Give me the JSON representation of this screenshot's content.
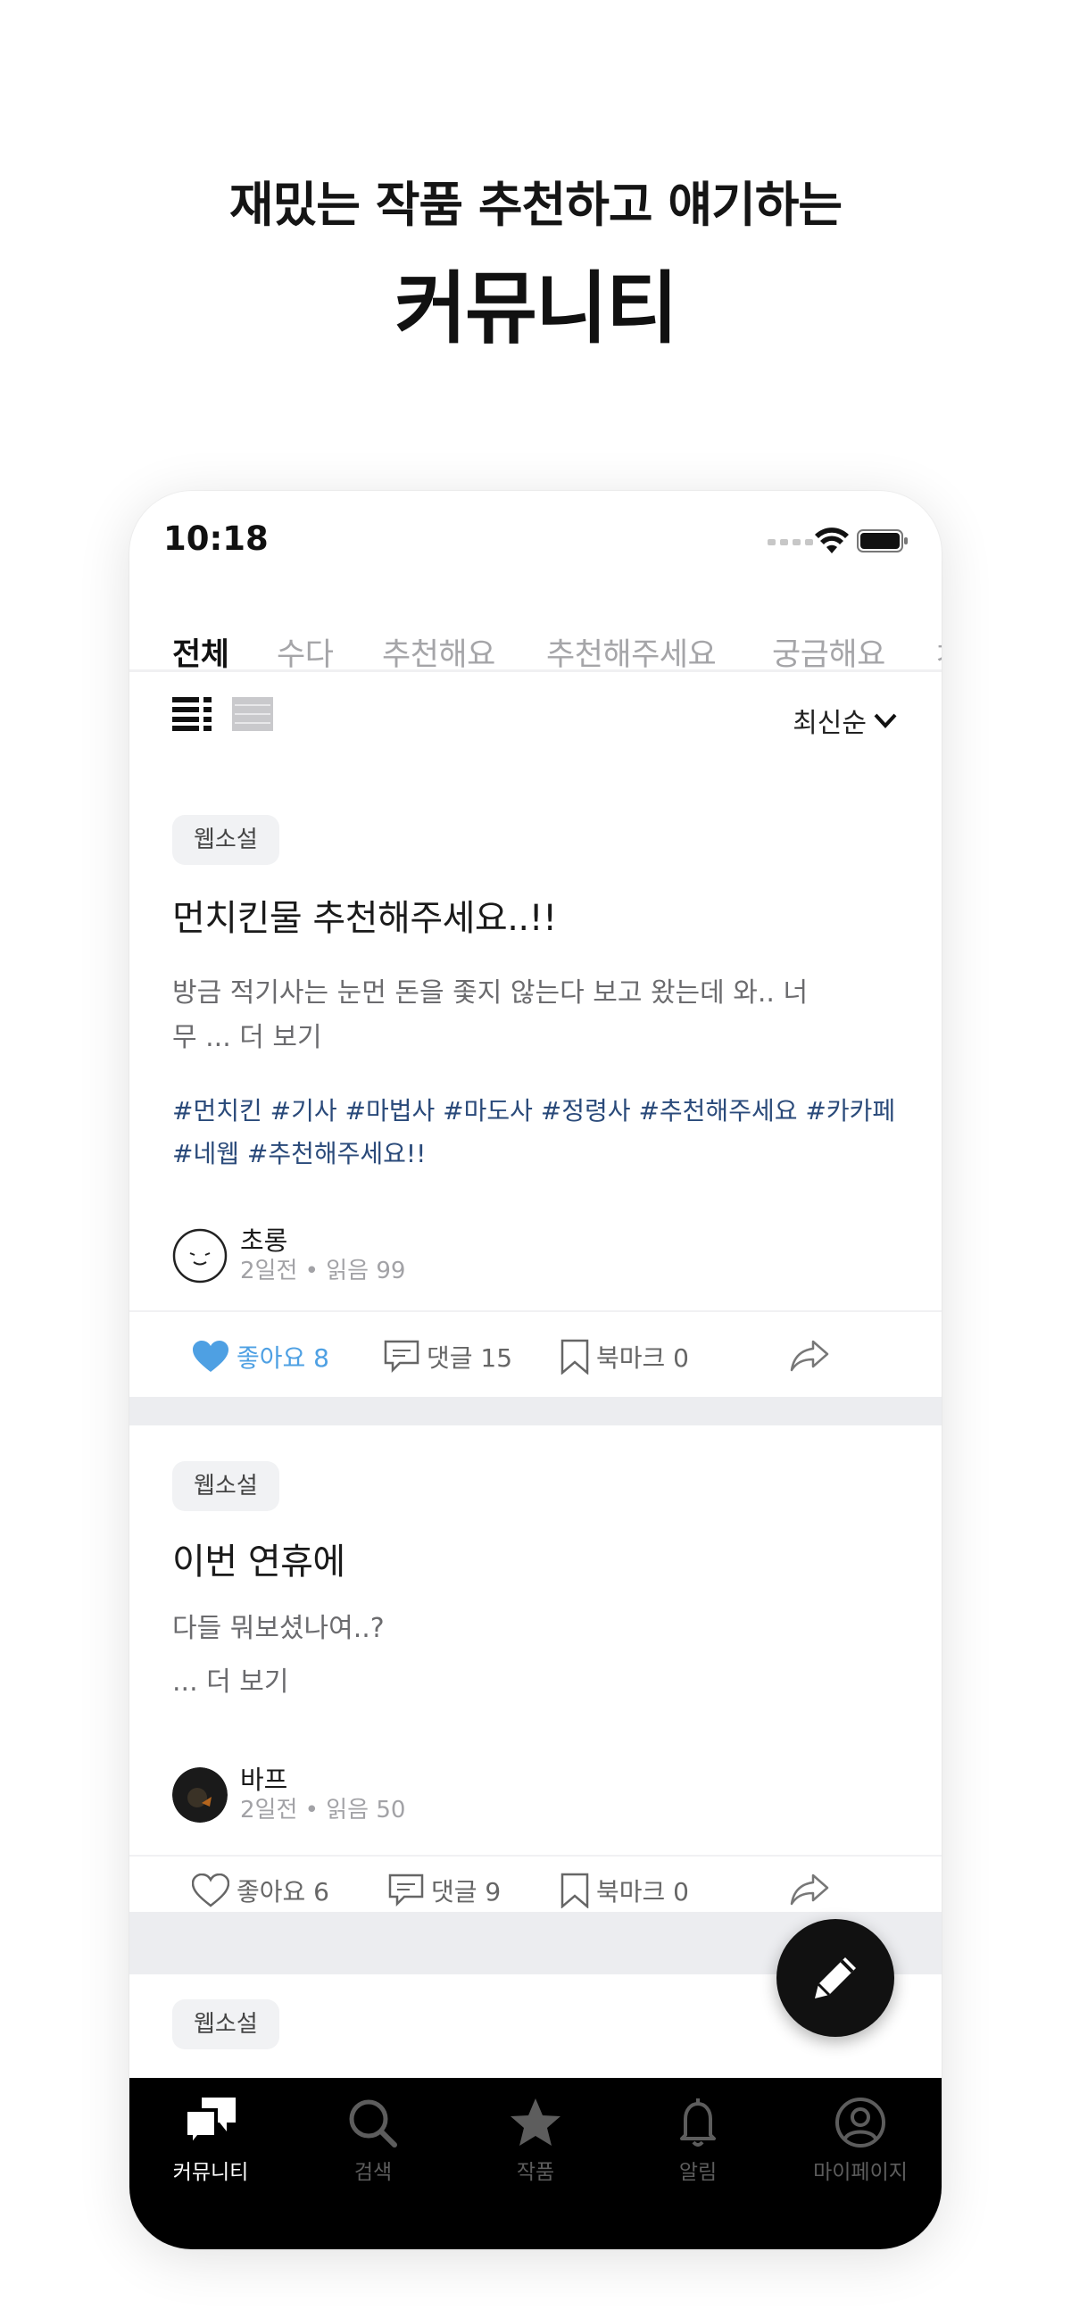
{
  "headline": {
    "sub": "재밌는 작품 추천하고 얘기하는",
    "main": "커뮤니티"
  },
  "status_bar": {
    "time": "10:18"
  },
  "tabs": [
    {
      "label": "전체",
      "active": true
    },
    {
      "label": "수다"
    },
    {
      "label": "추천해요"
    },
    {
      "label": "추천해주세요"
    },
    {
      "label": "궁금해요"
    },
    {
      "label": "ㅈ"
    }
  ],
  "toolbar": {
    "sort_label": "최신순"
  },
  "posts": [
    {
      "category": "웹소설",
      "title": "먼치킨물 추천해주세요..!!",
      "body_line1": "방금 적기사는 눈먼 돈을 좇지 않는다 보고 왔는데 와.. 너",
      "body_line2": "무  ... 더 보기",
      "hashtags_line1": "#먼치킨 #기사 #마법사 #마도사 #정령사 #추천해주세요 #카카페",
      "hashtags_line2": "#네웹 #추천해주세요!!",
      "author": "초롱",
      "meta": "2일전 • 읽음 99",
      "like_label": "좋아요 8",
      "comment_label": "댓글 15",
      "bookmark_label": "북마크 0",
      "liked": true
    },
    {
      "category": "웹소설",
      "title": "이번 연휴에",
      "body_line1": "다들 뭐보셨나여..?",
      "body_line2": " ... 더 보기",
      "author": "바프",
      "meta": "2일전 • 읽음 50",
      "like_label": "좋아요 6",
      "comment_label": "댓글 9",
      "bookmark_label": "북마크 0",
      "liked": false
    },
    {
      "category": "웹소설"
    }
  ],
  "tab_bar": [
    {
      "label": "커뮤니티",
      "icon": "community-icon",
      "active": true
    },
    {
      "label": "검색",
      "icon": "search-icon"
    },
    {
      "label": "작품",
      "icon": "star-icon"
    },
    {
      "label": "알림",
      "icon": "bell-icon"
    },
    {
      "label": "마이페이지",
      "icon": "profile-icon"
    }
  ],
  "colors": {
    "like_blue": "#4ea0e3",
    "hashtag_blue": "#2a4a7a",
    "tab_bar_bg": "#000000"
  }
}
